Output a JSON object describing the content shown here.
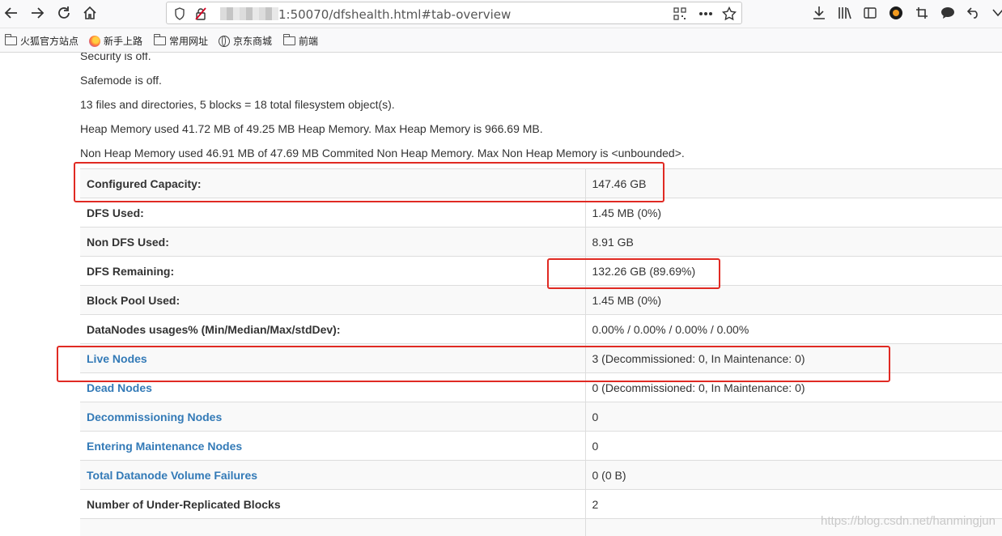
{
  "browser": {
    "url_visible": "1:50070/dfshealth.html#tab-overview",
    "bookmarks": [
      {
        "label": "火狐官方站点",
        "icon": "folder-icon"
      },
      {
        "label": "新手上路",
        "icon": "firefox-icon"
      },
      {
        "label": "常用网址",
        "icon": "folder-icon"
      },
      {
        "label": "京东商城",
        "icon": "globe-icon"
      },
      {
        "label": "前端",
        "icon": "folder-icon"
      }
    ]
  },
  "overview": {
    "lines": [
      "Security is off.",
      "Safemode is off.",
      "13 files and directories, 5 blocks = 18 total filesystem object(s).",
      "Heap Memory used 41.72 MB of 49.25 MB Heap Memory. Max Heap Memory is 966.69 MB.",
      "Non Heap Memory used 46.91 MB of 47.69 MB Commited Non Heap Memory. Max Non Heap Memory is <unbounded>."
    ],
    "rows": [
      {
        "label": "Configured Capacity:",
        "value": "147.46 GB",
        "link": false
      },
      {
        "label": "DFS Used:",
        "value": "1.45 MB (0%)",
        "link": false
      },
      {
        "label": "Non DFS Used:",
        "value": "8.91 GB",
        "link": false
      },
      {
        "label": "DFS Remaining:",
        "value": "132.26 GB (89.69%)",
        "link": false
      },
      {
        "label": "Block Pool Used:",
        "value": "1.45 MB (0%)",
        "link": false
      },
      {
        "label": "DataNodes usages% (Min/Median/Max/stdDev):",
        "value": "0.00% / 0.00% / 0.00% / 0.00%",
        "link": false
      },
      {
        "label": "Live Nodes",
        "value": "3 (Decommissioned: 0, In Maintenance: 0)",
        "link": true
      },
      {
        "label": "Dead Nodes",
        "value": "0 (Decommissioned: 0, In Maintenance: 0)",
        "link": true
      },
      {
        "label": "Decommissioning Nodes",
        "value": "0",
        "link": true
      },
      {
        "label": "Entering Maintenance Nodes",
        "value": "0",
        "link": true
      },
      {
        "label": "Total Datanode Volume Failures",
        "value": "0 (0 B)",
        "link": true
      },
      {
        "label": "Number of Under-Replicated Blocks",
        "value": "2",
        "link": false
      }
    ]
  },
  "watermark": "https://blog.csdn.net/hanmingjun",
  "colors": {
    "link": "#337ab7",
    "annotation": "#e02a23"
  }
}
